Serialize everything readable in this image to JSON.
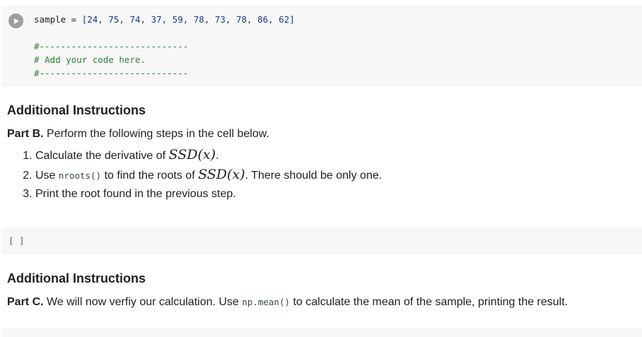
{
  "cell1": {
    "line1": {
      "var": "sample",
      "op": " = ",
      "arr": "[24, 75, 74, 37, 59, 78, 73, 78, 86, 62]"
    },
    "comment1": "#----------------------------",
    "comment2": "# Add your code here.",
    "comment3": "#----------------------------"
  },
  "textB": {
    "heading": "Additional Instructions",
    "part_label": "Part B.",
    "part_text": " Perform the following steps in the cell below.",
    "step1_pre": "Calculate the derivative of ",
    "step1_math": "SSD(x)",
    "step1_post": ".",
    "step2_pre": "Use ",
    "step2_code": "nroots()",
    "step2_mid": " to find the roots of ",
    "step2_math": "SSD(x)",
    "step2_post": ". There should be only one.",
    "step3": "Print the root found in the previous step."
  },
  "cell2": {
    "prompt": "[ ]"
  },
  "textC": {
    "heading": "Additional Instructions",
    "part_label": "Part C.",
    "part_text1": " We will now verfiy our calculation. Use ",
    "part_code": "np.mean()",
    "part_text2": " to calculate the mean of the sample, printing the result."
  }
}
